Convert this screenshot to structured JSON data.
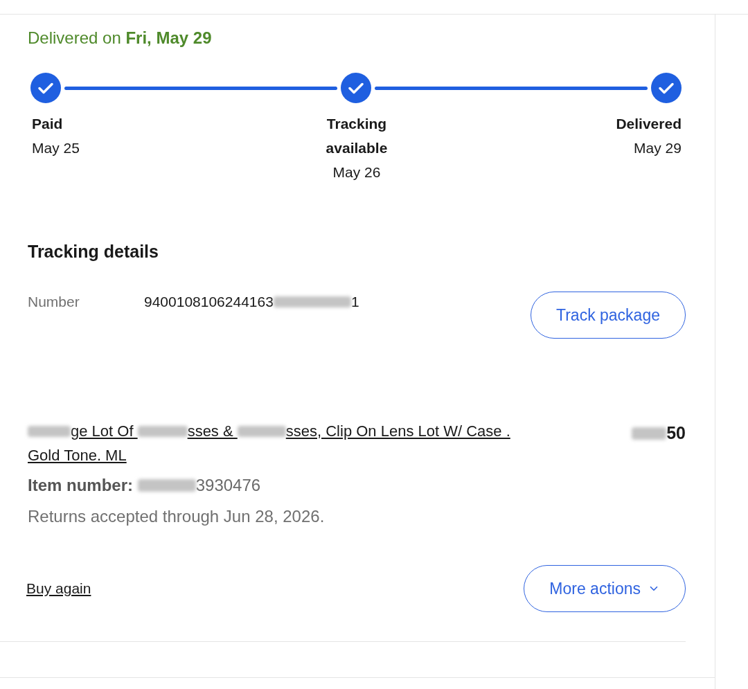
{
  "delivery_status": "Delivered on **Fri, May 29**",
  "progress": {
    "steps": [
      {
        "label": "Paid",
        "date": "May 25",
        "completed": true
      },
      {
        "label": "Tracking available",
        "date": "May 26",
        "completed": true
      },
      {
        "label": "Delivered",
        "date": "May 29",
        "completed": true
      }
    ]
  },
  "tracking_details": {
    "title": "Tracking details",
    "number_label": "Number",
    "number": [
      {
        "kind": "text",
        "text": "9400108106244163"
      },
      {
        "kind": "redacted"
      },
      {
        "kind": "text",
        "text": "1"
      }
    ],
    "button": "Track package"
  },
  "item": {
    "title": [
      {
        "kind": "redacted"
      },
      {
        "kind": "text",
        "text": "ge Lot Of "
      },
      {
        "kind": "redacted"
      },
      {
        "kind": "text",
        "text": "sses & "
      },
      {
        "kind": "redacted"
      },
      {
        "kind": "text",
        "text": "sses, Clip On Lens Lot W/ Case . Gold Tone. ML"
      }
    ],
    "price": [
      {
        "kind": "redacted"
      },
      {
        "kind": "text",
        "text": "50"
      }
    ],
    "item_number_label": "Item number:",
    "item_number": [
      {
        "kind": "redacted"
      },
      {
        "kind": "text",
        "text": "3930476"
      }
    ],
    "returns": "Returns accepted through Jun 28, 2026."
  },
  "actions": {
    "buy_again": "Buy again",
    "more_actions": "More actions"
  }
}
